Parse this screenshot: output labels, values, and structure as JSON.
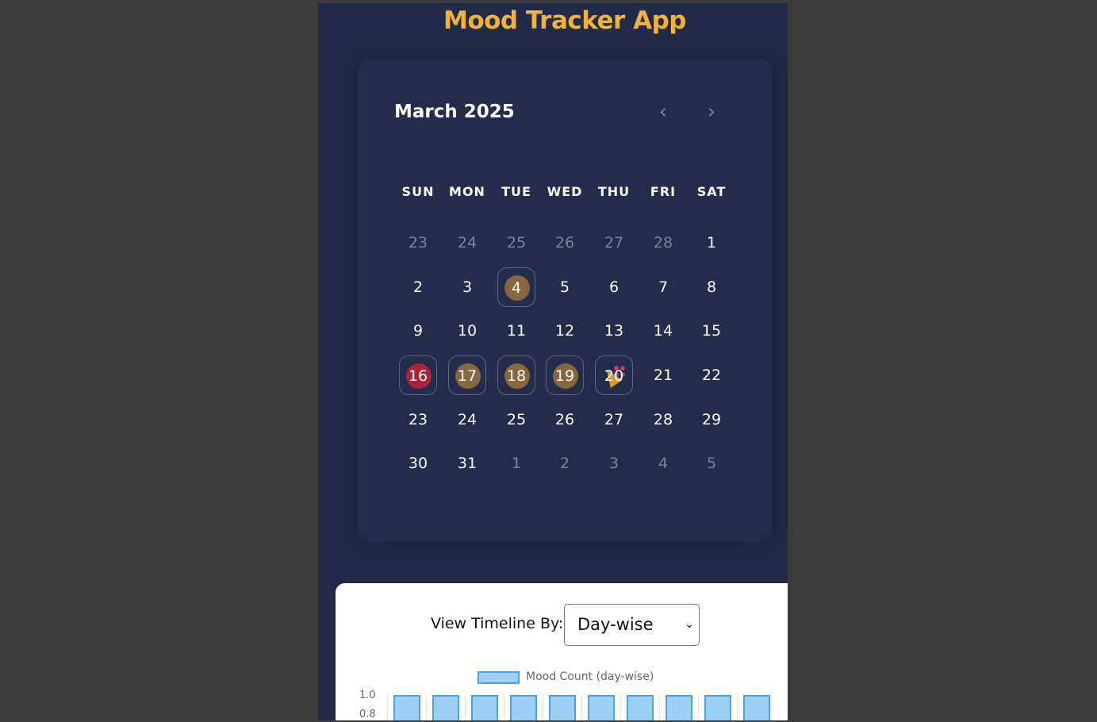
{
  "app": {
    "title": "Mood Tracker App"
  },
  "calendar": {
    "month_label": "March 2025",
    "prev_icon": "‹",
    "next_icon": "›",
    "weekdays": [
      "SUN",
      "MON",
      "TUE",
      "WED",
      "THU",
      "FRI",
      "SAT"
    ],
    "weeks": [
      [
        {
          "d": "23",
          "muted": true
        },
        {
          "d": "24",
          "muted": true
        },
        {
          "d": "25",
          "muted": true
        },
        {
          "d": "26",
          "muted": true
        },
        {
          "d": "27",
          "muted": true
        },
        {
          "d": "28",
          "muted": true
        },
        {
          "d": "1"
        }
      ],
      [
        {
          "d": "2"
        },
        {
          "d": "3"
        },
        {
          "d": "4",
          "mood": "thinking"
        },
        {
          "d": "5"
        },
        {
          "d": "6"
        },
        {
          "d": "7"
        },
        {
          "d": "8"
        }
      ],
      [
        {
          "d": "9"
        },
        {
          "d": "10"
        },
        {
          "d": "11"
        },
        {
          "d": "12"
        },
        {
          "d": "13"
        },
        {
          "d": "14"
        },
        {
          "d": "15"
        }
      ],
      [
        {
          "d": "16",
          "mood": "angry"
        },
        {
          "d": "17",
          "mood": "happy"
        },
        {
          "d": "18",
          "mood": "excited"
        },
        {
          "d": "19",
          "mood": "calm"
        },
        {
          "d": "20",
          "mood": "party"
        },
        {
          "d": "21"
        },
        {
          "d": "22"
        }
      ],
      [
        {
          "d": "23"
        },
        {
          "d": "24"
        },
        {
          "d": "25"
        },
        {
          "d": "26"
        },
        {
          "d": "27"
        },
        {
          "d": "28"
        },
        {
          "d": "29"
        }
      ],
      [
        {
          "d": "30"
        },
        {
          "d": "31"
        },
        {
          "d": "1",
          "muted": true
        },
        {
          "d": "2",
          "muted": true
        },
        {
          "d": "3",
          "muted": true
        },
        {
          "d": "4",
          "muted": true
        },
        {
          "d": "5",
          "muted": true
        }
      ]
    ]
  },
  "timeline": {
    "label": "View Timeline By:",
    "selected": "Day-wise"
  },
  "chart_data": {
    "type": "bar",
    "legend": [
      "Mood Count (day-wise)"
    ],
    "series": [
      {
        "name": "Mood Count (day-wise)",
        "values": [
          1,
          1,
          1,
          1,
          1,
          1,
          1,
          1,
          1,
          1
        ]
      }
    ],
    "y_ticks": [
      "1.0",
      "0.8"
    ],
    "colors": {
      "fill": "#9ecff5",
      "border": "#4ba3e6"
    }
  },
  "colors": {
    "accent": "#f2b33d",
    "background": "#212a46"
  }
}
